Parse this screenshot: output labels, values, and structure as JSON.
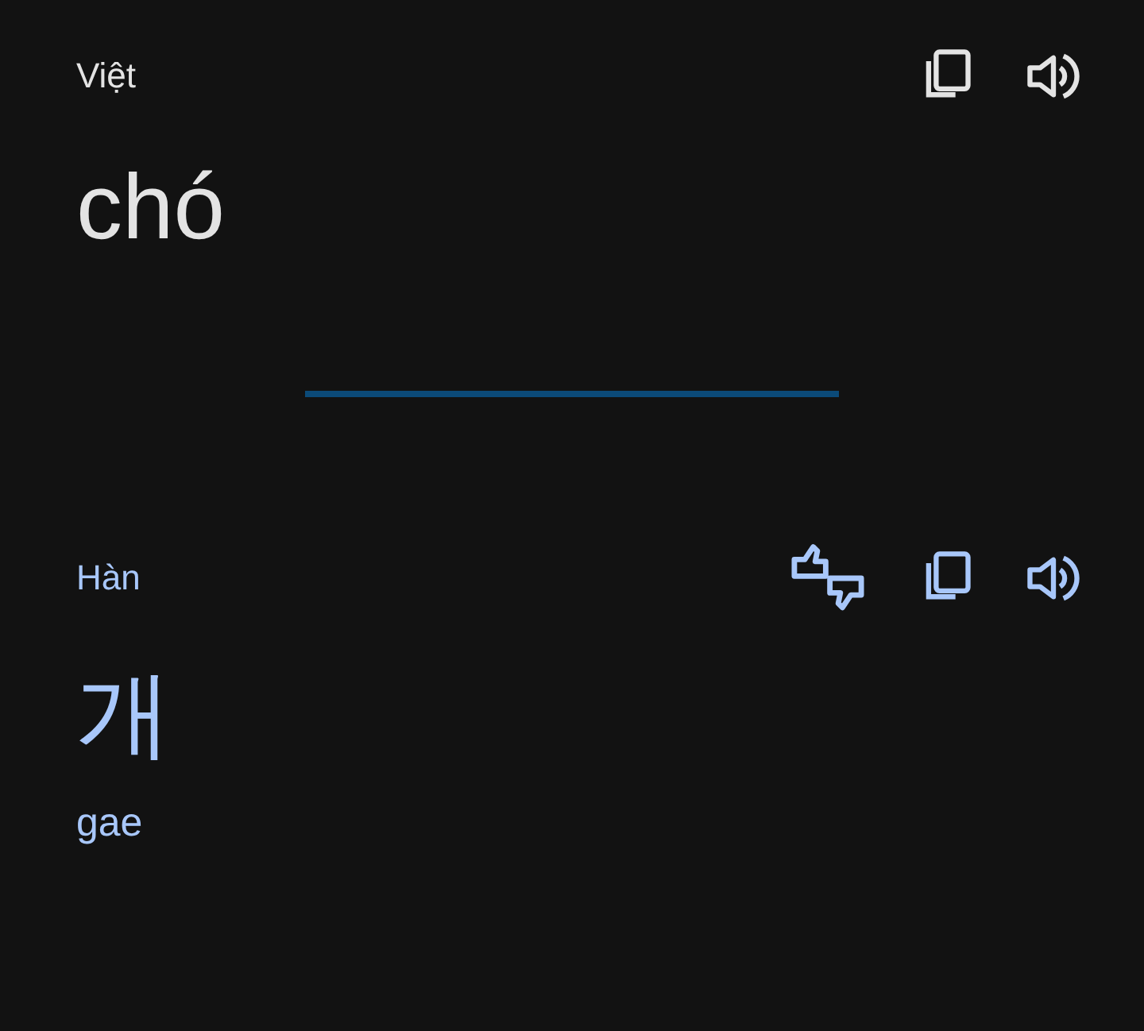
{
  "source": {
    "language": "Việt",
    "text": "chó"
  },
  "target": {
    "language": "Hàn",
    "text": "개",
    "romanization": "gae"
  }
}
